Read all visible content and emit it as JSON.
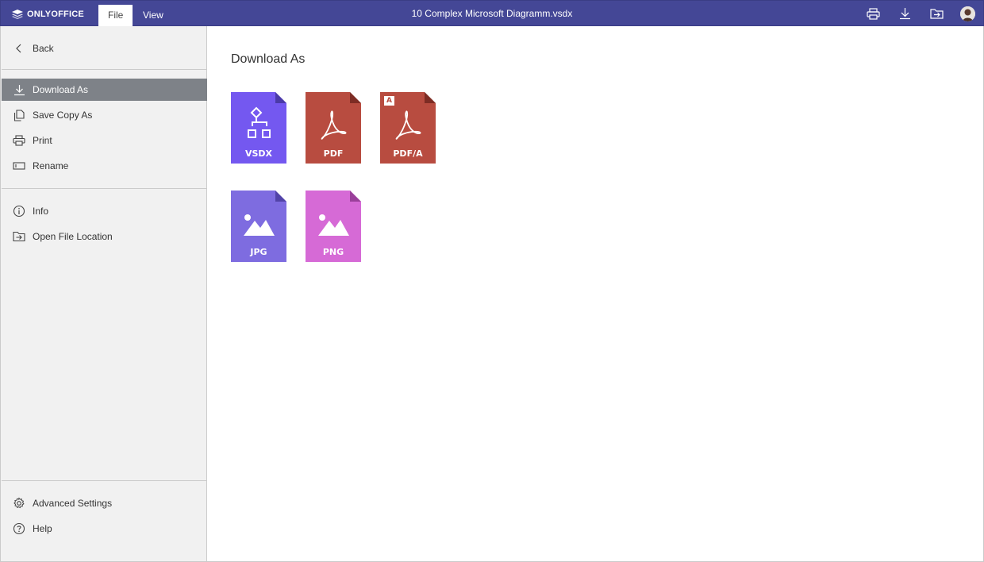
{
  "header": {
    "logo_text": "ONLYOFFICE",
    "tabs": [
      {
        "label": "File"
      },
      {
        "label": "View"
      }
    ],
    "doc_title": "10 Complex Microsoft Diagramm.vsdx",
    "icons": [
      "print-icon",
      "download-icon",
      "open-location-icon",
      "user-avatar"
    ],
    "colors": {
      "bar": "#444796"
    }
  },
  "sidebar": {
    "back_label": "Back",
    "items": [
      {
        "label": "Download As",
        "icon": "download-icon",
        "selected": true
      },
      {
        "label": "Save Copy As",
        "icon": "copy-icon"
      },
      {
        "label": "Print",
        "icon": "print-icon"
      },
      {
        "label": "Rename",
        "icon": "rename-icon"
      },
      {
        "label": "Info",
        "icon": "info-icon"
      },
      {
        "label": "Open File Location",
        "icon": "folder-arrow-icon"
      },
      {
        "label": "Advanced Settings",
        "icon": "gear-icon"
      },
      {
        "label": "Help",
        "icon": "help-icon"
      }
    ]
  },
  "main": {
    "title": "Download As",
    "formats": [
      {
        "label": "VSDX",
        "color": "#7458f0"
      },
      {
        "label": "PDF",
        "color": "#b84c40"
      },
      {
        "label": "PDF/A",
        "color": "#b84c40",
        "badge": "A"
      },
      {
        "label": "JPG",
        "color": "#7e6ce0"
      },
      {
        "label": "PNG",
        "color": "#d66ad6"
      }
    ]
  }
}
